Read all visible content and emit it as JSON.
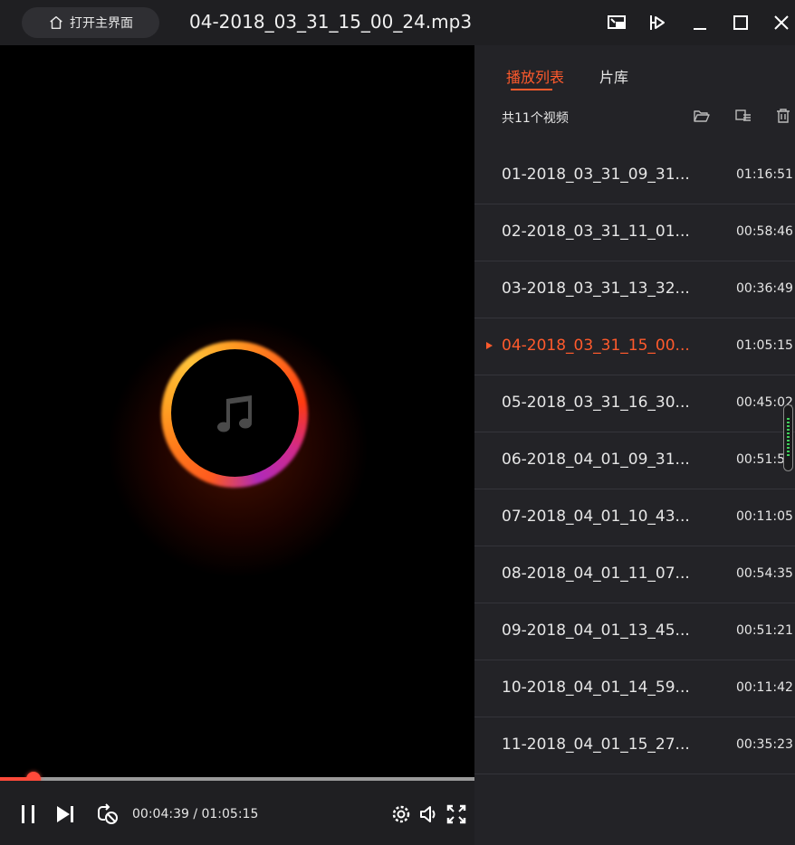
{
  "titlebar": {
    "home_label": "打开主界面",
    "file_title": "04-2018_03_31_15_00_24.mp3"
  },
  "player": {
    "current_time": "00:04:39",
    "total_time": "01:05:15",
    "time_display": "00:04:39 / 01:05:15",
    "progress_fraction": 0.071
  },
  "sidebar": {
    "tabs": [
      {
        "label": "播放列表",
        "active": true
      },
      {
        "label": "片库",
        "active": false
      }
    ],
    "count_label": "共11个视频",
    "items": [
      {
        "name": "01-2018_03_31_09_31...",
        "duration": "01:16:51"
      },
      {
        "name": "02-2018_03_31_11_01...",
        "duration": "00:58:46"
      },
      {
        "name": "03-2018_03_31_13_32...",
        "duration": "00:36:49"
      },
      {
        "name": "04-2018_03_31_15_00...",
        "duration": "01:05:15",
        "playing": true
      },
      {
        "name": "05-2018_03_31_16_30...",
        "duration": "00:45:02"
      },
      {
        "name": "06-2018_04_01_09_31...",
        "duration": "00:51:5"
      },
      {
        "name": "07-2018_04_01_10_43...",
        "duration": "00:11:05"
      },
      {
        "name": "08-2018_04_01_11_07...",
        "duration": "00:54:35"
      },
      {
        "name": "09-2018_04_01_13_45...",
        "duration": "00:51:21"
      },
      {
        "name": "10-2018_04_01_14_59...",
        "duration": "00:11:42"
      },
      {
        "name": "11-2018_04_01_15_27...",
        "duration": "00:35:23"
      }
    ]
  },
  "colors": {
    "accent": "#ff5a2c",
    "progress": "#ff4a3a",
    "panel": "#232327",
    "bar": "#1f1f22"
  }
}
